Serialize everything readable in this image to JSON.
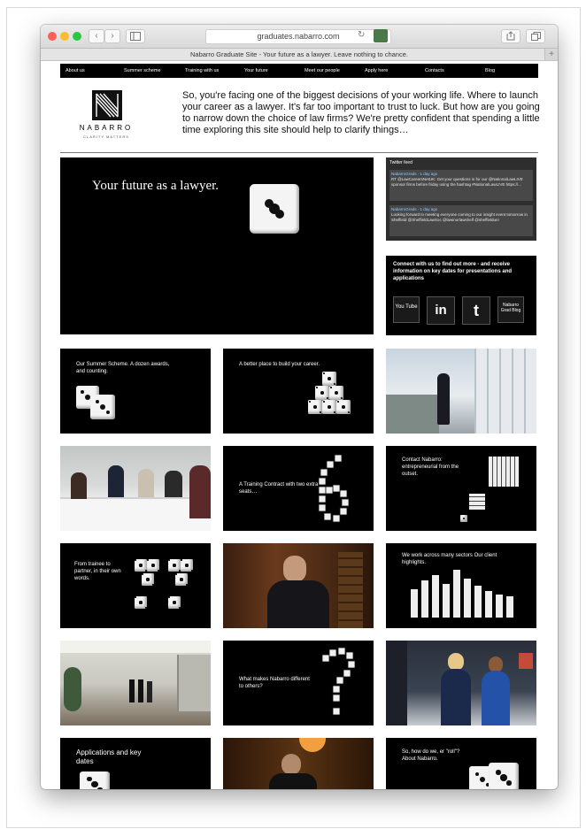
{
  "browser": {
    "url": "graduates.nabarro.com",
    "tab_title": "Nabarro Graduate Site - Your future as a lawyer. Leave nothing to chance.",
    "new_tab_symbol": "+",
    "back_symbol": "‹",
    "forward_symbol": "›",
    "reload_symbol": "↻"
  },
  "nav": {
    "items": [
      "About us",
      "Summer scheme",
      "Training with us",
      "Your future",
      "Meet our people",
      "Apply here",
      "Contacts",
      "Blog"
    ]
  },
  "logo": {
    "text": "NABARRO",
    "tagline": "CLARITY MATTERS"
  },
  "intro": "So, you're facing one of the biggest decisions of your working life. Where to launch your career as a lawyer. It's far too important to trust to luck. But how are you going to narrow down the choice of law firms? We're pretty confident that spending a little time exploring this site should help to clarify things…",
  "hero": {
    "title": "Your future as a lawyer."
  },
  "twitter": {
    "heading": "Twitter feed",
    "tweets": [
      {
        "meta": "NabarroGrads - 1 day ago",
        "text": "RT @LawCareersNetUK: Get your questions in for our @NationalLawLIVE sponsor firms before friday using the hashtag #NationalLawLIVE https://..."
      },
      {
        "meta": "NabarroGrads - 1 day ago",
        "text": "Looking forward to meeting everyone coming to our insight event tomorrow in Sheffield @SheffieldLawSoc @lawinorlawshelf @sheffieldun!"
      }
    ]
  },
  "connect": {
    "title": "Connect with us to find out more - and receive information on key dates for presentations and applications",
    "buttons": [
      {
        "label": "You Tube"
      },
      {
        "label": "in"
      },
      {
        "label": "t"
      },
      {
        "label": "Nabarro Grad Blog"
      }
    ]
  },
  "tiles": [
    {
      "caption": "Our Summer Scheme. A dozen awards, and counting."
    },
    {
      "caption": "A better place to build your career."
    },
    {
      "caption": "A Training Contract with two extra seats…"
    },
    {
      "caption": "Contact Nabarro: entrepreneurial from the outset."
    },
    {
      "caption": "From trainee to partner, in their own words."
    },
    {
      "caption": "We work across many sectors Our client highlights."
    },
    {
      "caption": "What makes Nabarro different to others?"
    },
    {
      "caption": "Applications and key dates"
    },
    {
      "caption": "So, how do we, er \"roll\"? About Nabarro."
    }
  ],
  "colors": {
    "brand_black": "#000000",
    "twitter_link": "#8ecbff",
    "close": "#fc5f57",
    "minimize": "#fdbc2e",
    "zoom": "#28c840"
  }
}
